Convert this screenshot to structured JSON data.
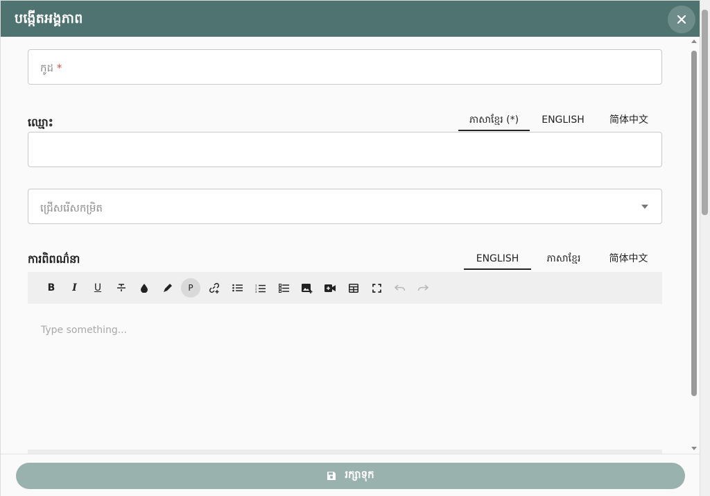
{
  "dialog": {
    "title": "បង្កើតអង្គភាព",
    "header_color": "#4f7370",
    "close_icon": "close-icon"
  },
  "code_field": {
    "placeholder": "កូដ",
    "required_mark": "*"
  },
  "name_section": {
    "label": "ឈ្មោះ",
    "tabs": [
      "ភាសាខ្មែរ (*)",
      "ENGLISH",
      "简体中文"
    ],
    "active_tab": 0
  },
  "level_select": {
    "placeholder": "ជ្រើសរើសកម្រិត",
    "icon": "chevron-down-icon"
  },
  "description_section": {
    "label": "ការពិពណ៌នា",
    "tabs": [
      "ENGLISH",
      "ភាសាខ្មែរ",
      "简体中文"
    ],
    "active_tab": 0
  },
  "toolbar": {
    "bold": "B",
    "italic": "I",
    "underline": "U",
    "paragraph": "P"
  },
  "editor": {
    "placeholder": "Type something..."
  },
  "footer": {
    "save_label": "រក្សាទុក",
    "save_color": "#9ab2ad"
  }
}
